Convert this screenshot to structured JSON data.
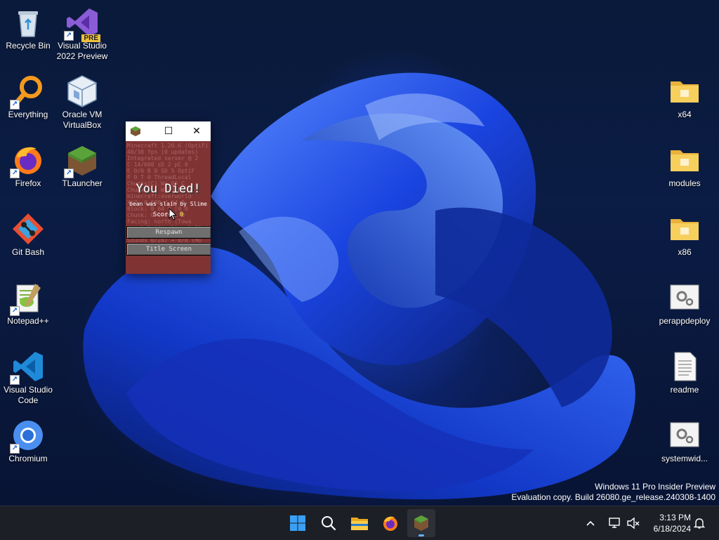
{
  "desktop": {
    "left_icons": [
      {
        "label_1": "Recycle Bin",
        "label_2": "",
        "icon": "recycle-bin-icon"
      },
      {
        "label_1": "Visual Studio",
        "label_2": "2022 Preview",
        "icon": "visual-studio-icon",
        "badge": "PRE"
      },
      {
        "label_1": "Everything",
        "label_2": "",
        "icon": "everything-search-icon"
      },
      {
        "label_1": "Oracle VM",
        "label_2": "VirtualBox",
        "icon": "virtualbox-icon"
      },
      {
        "label_1": "Firefox",
        "label_2": "",
        "icon": "firefox-icon"
      },
      {
        "label_1": "TLauncher",
        "label_2": "",
        "icon": "tlauncher-icon"
      },
      {
        "label_1": "Git Bash",
        "label_2": "",
        "icon": "git-bash-icon"
      },
      {
        "label_1": "Notepad++",
        "label_2": "",
        "icon": "notepadpp-icon"
      },
      {
        "label_1": "Visual Studio",
        "label_2": "Code",
        "icon": "vscode-icon"
      },
      {
        "label_1": "Chromium",
        "label_2": "",
        "icon": "chromium-icon"
      }
    ],
    "right_icons": [
      {
        "label": "x64",
        "icon": "folder-icon"
      },
      {
        "label": "modules",
        "icon": "folder-icon"
      },
      {
        "label": "x86",
        "icon": "folder-icon"
      },
      {
        "label": "perappdeploy",
        "icon": "settings-file-icon"
      },
      {
        "label": "readme",
        "icon": "text-file-icon"
      },
      {
        "label": "systemwid...",
        "icon": "settings-file-icon"
      }
    ]
  },
  "minecraft_window": {
    "title_controls": {
      "minimize": "—",
      "maximize": "☐",
      "close": "✕"
    },
    "debug_lines": [
      "Minecraft 1.20.6 (OptiFi",
      "40/38 fps (0 updates)",
      "Integrated server @ 2",
      "C 14/600 sD 2 pC 0",
      "E 0/0 B 0 SD 5 OptiF",
      "P 0 T 0 ThreadLocal",
      "Chunks[C] W: 00 C",
      "Chunks[S] W: 0 E: 0",
      "minecraft:overworld",
      "XYZ: 0.500 / 64.0",
      "Block: 0 64 0 [0 0",
      "Chunk: 0 4 0 in 0",
      "Facing: north (Towa",
      "Local Difficulty: 1.50 //",
      "SC 0 M 37 C 12 M 0",
      "Sounds 0/247 + 0/8 (Mo"
    ],
    "death_title": "You Died!",
    "death_message": "bean was slain by Slime",
    "score_label": "Score: ",
    "score_value": "0",
    "respawn_button": "Respawn",
    "title_screen_button": "Title Screen"
  },
  "watermark": {
    "line1": "Windows 11 Pro Insider Preview",
    "line2": "Evaluation copy. Build 26080.ge_release.240308-1400"
  },
  "taskbar": {
    "apps": [
      {
        "name": "start",
        "icon": "windows-start-icon"
      },
      {
        "name": "search",
        "icon": "search-icon"
      },
      {
        "name": "file-explorer",
        "icon": "file-explorer-icon"
      },
      {
        "name": "firefox",
        "icon": "firefox-icon"
      },
      {
        "name": "minecraft",
        "icon": "minecraft-icon",
        "active": true
      }
    ],
    "tray": {
      "chevron": "^",
      "time": "3:13 PM",
      "date": "6/18/2024"
    }
  }
}
